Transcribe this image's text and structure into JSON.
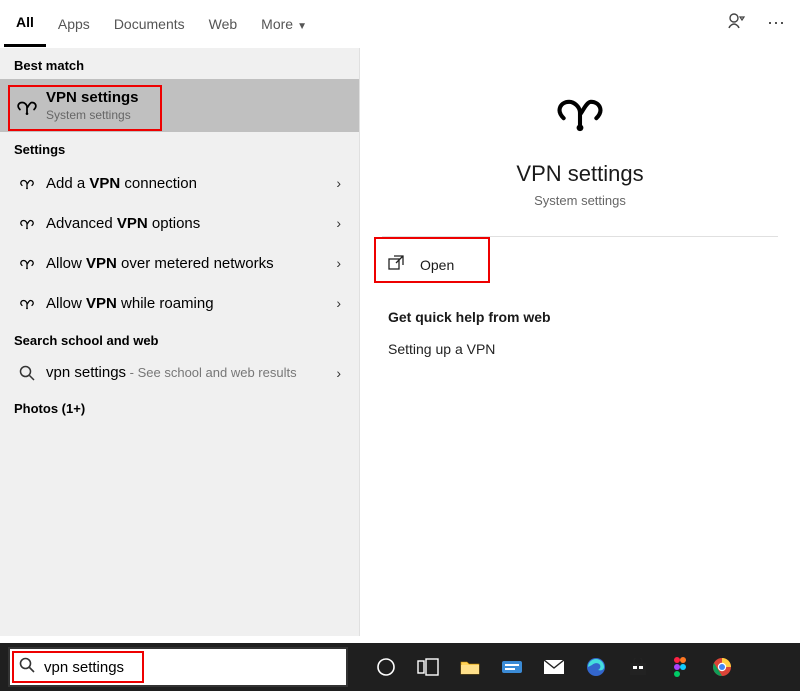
{
  "tabs": {
    "all": "All",
    "apps": "Apps",
    "documents": "Documents",
    "web": "Web",
    "more": "More"
  },
  "sections": {
    "best_match": "Best match",
    "settings": "Settings",
    "search_school_web": "Search school and web",
    "photos": "Photos (1+)"
  },
  "best_match_item": {
    "title": "VPN settings",
    "subtitle": "System settings"
  },
  "settings_items": [
    {
      "prefix": "Add a ",
      "bold": "VPN",
      "suffix": " connection"
    },
    {
      "prefix": "Advanced ",
      "bold": "VPN",
      "suffix": " options"
    },
    {
      "prefix": "Allow ",
      "bold": "VPN",
      "suffix": " over metered networks"
    },
    {
      "prefix": "Allow ",
      "bold": "VPN",
      "suffix": " while roaming"
    }
  ],
  "web_item": {
    "term": "vpn settings",
    "hint": " - See school and web results"
  },
  "detail": {
    "title": "VPN settings",
    "subtitle": "System settings",
    "open": "Open",
    "help_heading": "Get quick help from web",
    "help_link": "Setting up a VPN"
  },
  "search_input": "vpn settings"
}
